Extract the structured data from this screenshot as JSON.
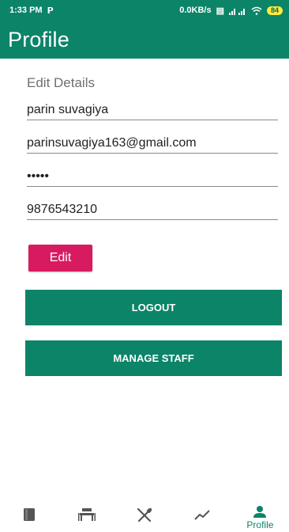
{
  "status_bar": {
    "time": "1:33 PM",
    "network_speed": "0.0KB/s",
    "battery": "84"
  },
  "app_bar": {
    "title": "Profile"
  },
  "form": {
    "section_label": "Edit Details",
    "name_value": "parin suvagiya",
    "email_value": "parinsuvagiya163@gmail.com",
    "password_value": "•••••",
    "phone_value": "9876543210",
    "edit_label": "Edit"
  },
  "actions": {
    "logout_label": "LOGOUT",
    "manage_staff_label": "MANAGE STAFF"
  },
  "bottom_nav": {
    "items": [
      {
        "icon": "book-icon"
      },
      {
        "icon": "table-icon"
      },
      {
        "icon": "utensils-icon"
      },
      {
        "icon": "trend-icon"
      },
      {
        "icon": "person-icon",
        "label": "Profile"
      }
    ]
  },
  "colors": {
    "primary": "#0b8468",
    "accent": "#d81b60",
    "inactive_icon": "#555555"
  }
}
